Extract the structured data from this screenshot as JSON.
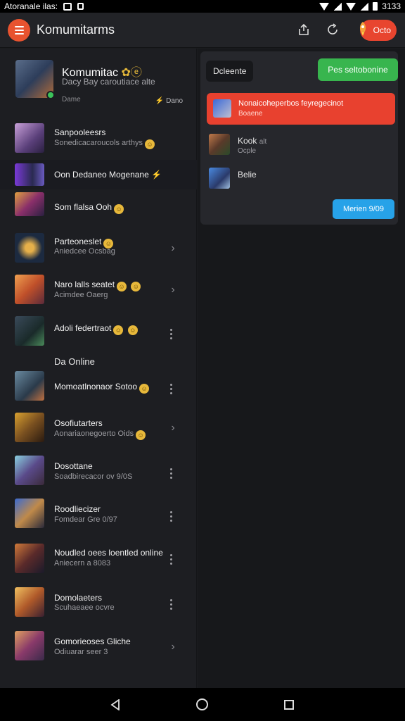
{
  "status_bar": {
    "left_text": "Atoranale ilas:",
    "time": "3133"
  },
  "appbar": {
    "title": "Komumitarms",
    "badge_label": "Octo"
  },
  "profile": {
    "name": "Komumitac",
    "subtitle": "Dacy Bay caroutiace alte",
    "meta": "Dame",
    "status": "Dano"
  },
  "sidebar": {
    "items": [
      {
        "name": "Sanpooleesrs",
        "sub": "Sonedicacaroucols arthys"
      },
      {
        "name": "Oon Dedaneo Mogenane",
        "sub": ""
      },
      {
        "name": "Som flalsa Ooh",
        "sub": ""
      },
      {
        "name": "Parteoneslet",
        "sub": "Aniedcee Ocsbag"
      },
      {
        "name": "Naro lalls seatet",
        "sub": "Acimdee Oaerg"
      },
      {
        "name": "Adoli federtraot",
        "sub": ""
      },
      {
        "name": "Momoatlnonaor Sotoo",
        "sub": ""
      },
      {
        "name": "Osofiutarters",
        "sub": "Aonariaonegoerto Oids"
      },
      {
        "name": "Dosottane",
        "sub": "Soadbirecacor ov 9/0S"
      },
      {
        "name": "Roodliecizer",
        "sub": "Fomdear Gre 0/97"
      },
      {
        "name": "Noudled oees loentled online",
        "sub": "Aniecern a 8083"
      },
      {
        "name": "Domolaeters",
        "sub": "Scuhaeaee ocvre"
      },
      {
        "name": "Gomorieoses Gliche",
        "sub": "Odiuarar seer 3"
      }
    ],
    "section_label": "Da Online"
  },
  "panel": {
    "chip_label": "Dcleente",
    "go_button": "Pes seltobonine",
    "notification": {
      "title": "Nonaicoheperbos feyregecinot",
      "sub": "Boaene"
    },
    "rows": [
      {
        "title": "Kook",
        "tag": "alt",
        "sub": "Ocple"
      },
      {
        "title": "Belie",
        "sub": ""
      }
    ],
    "blue_button": "Merien 9/09"
  },
  "colors": {
    "accent": "#e8532f",
    "green": "#38b54e",
    "blue": "#27a2e8",
    "background": "#1b1c1f"
  }
}
